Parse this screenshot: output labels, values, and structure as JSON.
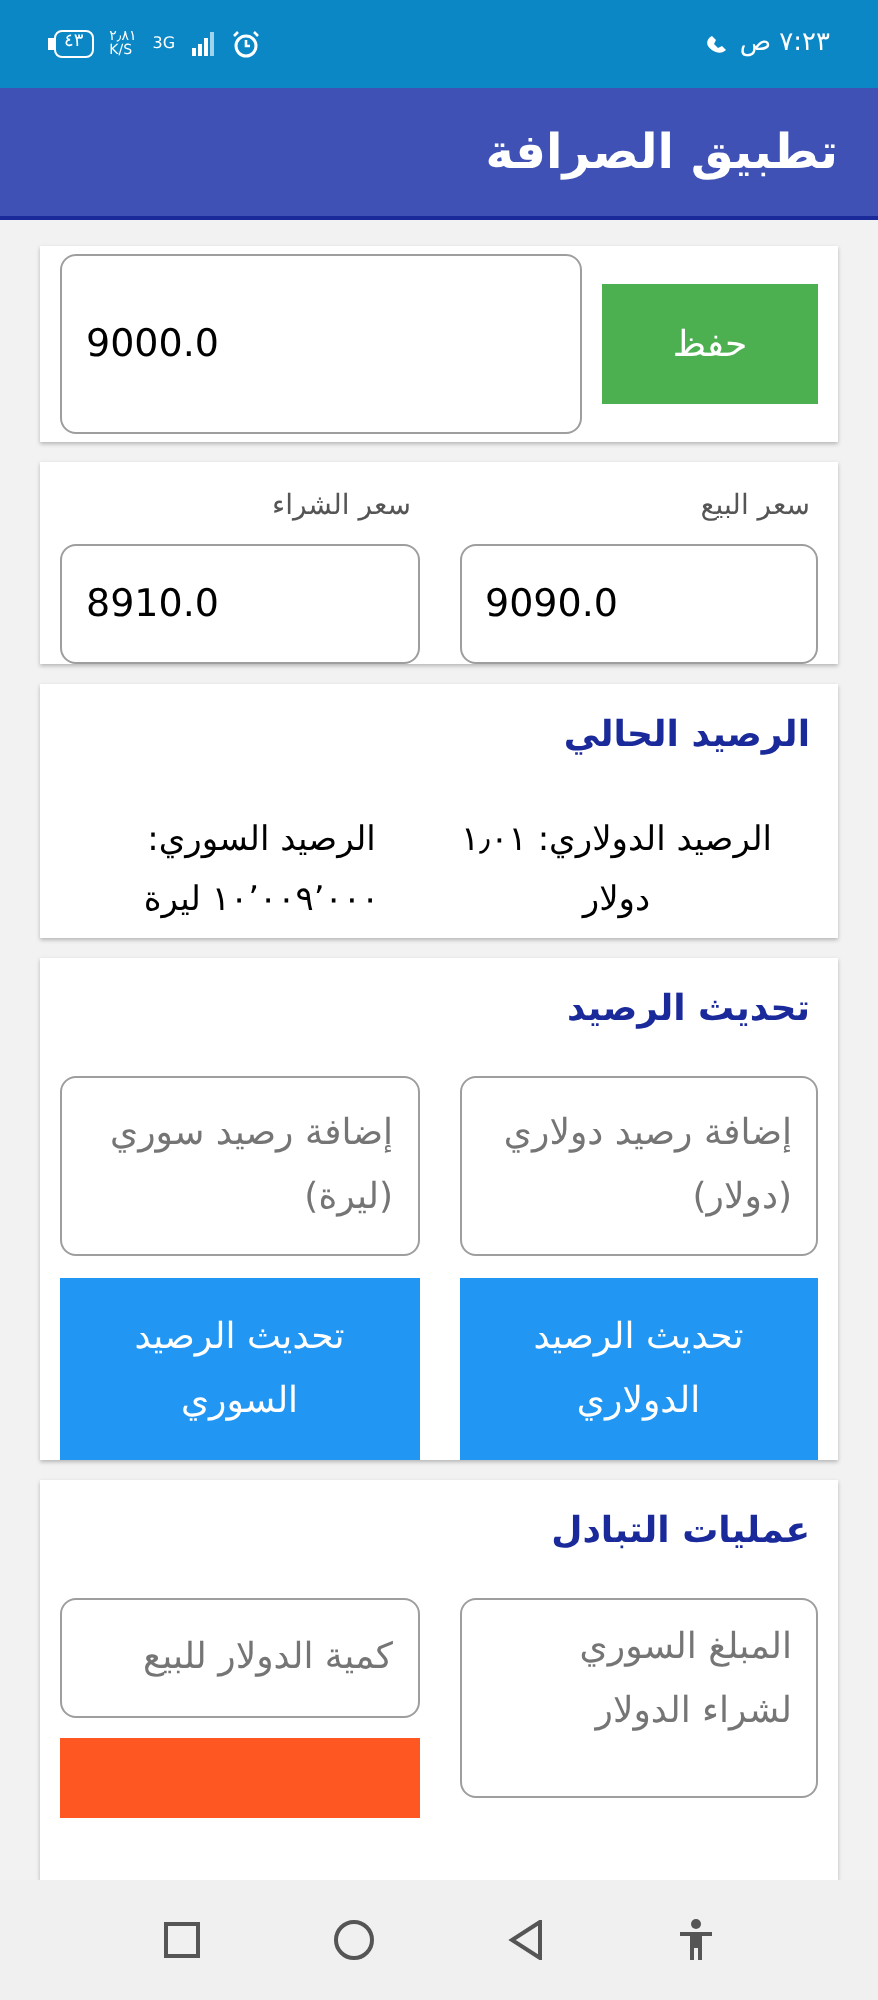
{
  "status_bar": {
    "time": "٧:٢٣ ص",
    "battery": "٤٣",
    "speed": "٢٫٨١",
    "speed_unit": "K/S",
    "network": "3G"
  },
  "app_bar": {
    "title": "تطبيق الصرافة"
  },
  "rate_card": {
    "value": "9000.0",
    "button": "حفظ"
  },
  "prices_card": {
    "fields": [
      {
        "label": "سعر البيع",
        "value": "9090.0"
      },
      {
        "label": "سعر الشراء",
        "value": "8910.0"
      }
    ]
  },
  "balance_card": {
    "title": "الرصيد الحالي",
    "lines": [
      "الرصيد الدولاري: ١٫٠١ دولار",
      "الرصيد السوري: ١٠٬٠٠٩٬٠٠٠ ليرة"
    ]
  },
  "update_card": {
    "title": "تحديث الرصيد",
    "fields": [
      {
        "placeholder": "إضافة رصيد دولاري (دولار)"
      },
      {
        "placeholder": "إضافة رصيد سوري (ليرة)"
      }
    ],
    "buttons": [
      "تحديث الرصيد الدولاري",
      "تحديث الرصيد السوري"
    ]
  },
  "exchange_card": {
    "title": "عمليات التبادل",
    "fields": [
      {
        "placeholder": "المبلغ السوري لشراء الدولار"
      },
      {
        "placeholder": "كمية الدولار للبيع"
      }
    ]
  }
}
